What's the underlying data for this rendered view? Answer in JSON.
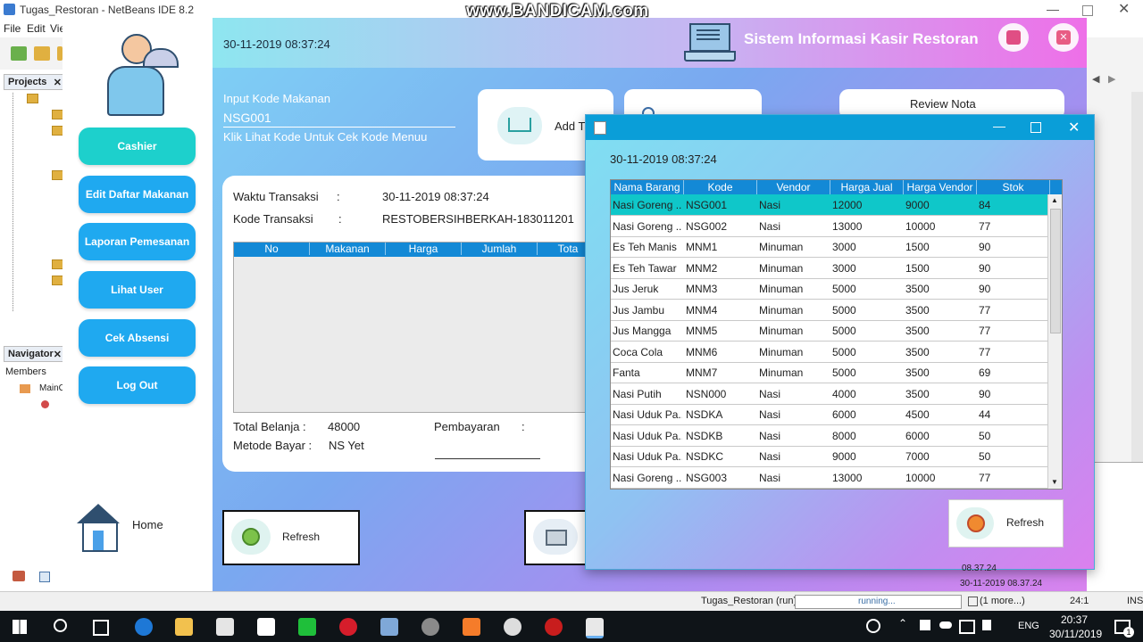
{
  "ide": {
    "title": "Tugas_Restoran - NetBeans IDE 8.2",
    "menu": [
      "File",
      "Edit",
      "Vie"
    ],
    "projects_tab": "Projects",
    "navigator_tab": "Navigator",
    "members_label": "Members",
    "nav_item": "MainC",
    "status_run": "Tugas_Restoran (run)",
    "status_running": "running...",
    "status_more": "(1 more...)",
    "status_pos": "24:1",
    "status_ins": "INS",
    "log_time1": "08.37.24",
    "log_time2": "30-11-2019 08.37.24"
  },
  "watermark": "www.BANDICAM.com",
  "app": {
    "datetime": "30-11-2019 08:37:24",
    "title": "Sistem Informasi Kasir Restoran",
    "nav": [
      "Cashier",
      "Edit Daftar Makanan",
      "Laporan Pemesanan",
      "Lihat User",
      "Cek Absensi",
      "Log Out"
    ],
    "home_label": "Home",
    "input_label": "Input Kode Makanan",
    "input_value": "NSG001",
    "input_hint": "Klik Lihat Kode Untuk Cek Kode Menuu",
    "add_label": "Add T",
    "review_label": "Review Nota",
    "waktu_label": "Waktu Transaksi",
    "waktu_colon": ":",
    "waktu_value": "30-11-2019 08:37:24",
    "kode_label": "Kode Transaksi",
    "kode_colon": ":",
    "kode_value": "RESTOBERSIHBERKAH-183011201",
    "order_headers": [
      "No",
      "Makanan",
      "Harga",
      "Jumlah",
      "Tota"
    ],
    "total_label": "Total Belanja :",
    "total_value": "48000",
    "metode_label": "Metode Bayar :",
    "metode_value": "NS Yet",
    "bayar_label": "Pembayaran",
    "bayar_colon": ":",
    "refresh_label": "Refresh"
  },
  "dialog": {
    "datetime": "30-11-2019 08:37:24",
    "headers": [
      "Nama Barang",
      "Kode",
      "Vendor",
      "Harga Jual",
      "Harga Vendor",
      "Stok"
    ],
    "rows": [
      [
        "Nasi Goreng ...",
        "NSG001",
        "Nasi",
        "12000",
        "9000",
        "84"
      ],
      [
        "Nasi Goreng ...",
        "NSG002",
        "Nasi",
        "13000",
        "10000",
        "77"
      ],
      [
        "Es Teh Manis",
        "MNM1",
        "Minuman",
        "3000",
        "1500",
        "90"
      ],
      [
        "Es Teh Tawar",
        "MNM2",
        "Minuman",
        "3000",
        "1500",
        "90"
      ],
      [
        "Jus Jeruk",
        "MNM3",
        "Minuman",
        "5000",
        "3500",
        "90"
      ],
      [
        "Jus Jambu",
        "MNM4",
        "Minuman",
        "5000",
        "3500",
        "77"
      ],
      [
        "Jus Mangga",
        "MNM5",
        "Minuman",
        "5000",
        "3500",
        "77"
      ],
      [
        "Coca Cola",
        "MNM6",
        "Minuman",
        "5000",
        "3500",
        "77"
      ],
      [
        "Fanta",
        "MNM7",
        "Minuman",
        "5000",
        "3500",
        "69"
      ],
      [
        "Nasi Putih",
        "NSN000",
        "Nasi",
        "4000",
        "3500",
        "90"
      ],
      [
        "Nasi Uduk Pa...",
        "NSDKA",
        "Nasi",
        "6000",
        "4500",
        "44"
      ],
      [
        "Nasi Uduk Pa...",
        "NSDKB",
        "Nasi",
        "8000",
        "6000",
        "50"
      ],
      [
        "Nasi Uduk Pa...",
        "NSDKC",
        "Nasi",
        "9000",
        "7000",
        "50"
      ],
      [
        "Nasi Goreng ...",
        "NSG003",
        "Nasi",
        "13000",
        "10000",
        "77"
      ]
    ],
    "refresh_label": "Refresh"
  },
  "taskbar": {
    "lang": "ENG",
    "time": "20:37",
    "date": "30/11/2019",
    "notif_count": "1"
  }
}
